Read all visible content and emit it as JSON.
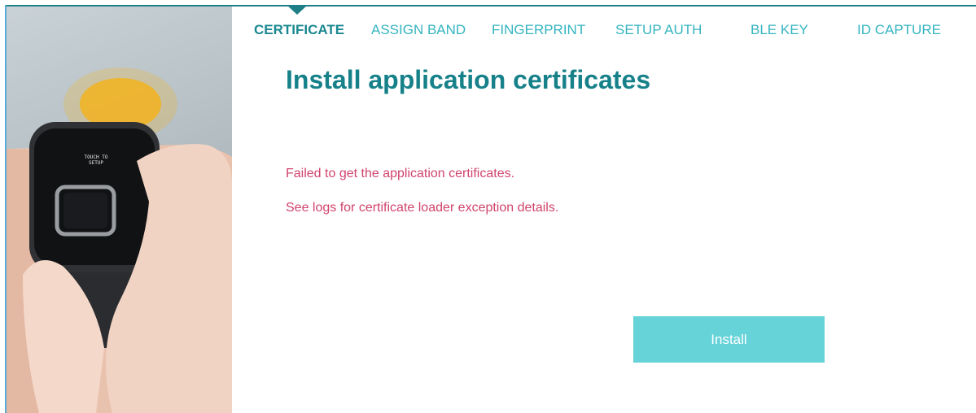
{
  "tabs": [
    {
      "label": "CERTIFICATE",
      "active": true
    },
    {
      "label": "ASSIGN BAND",
      "active": false
    },
    {
      "label": "FINGERPRINT",
      "active": false
    },
    {
      "label": "SETUP AUTH",
      "active": false
    },
    {
      "label": "BLE KEY",
      "active": false
    },
    {
      "label": "ID CAPTURE",
      "active": false
    }
  ],
  "main": {
    "title": "Install application certificates",
    "errors": [
      "Failed to get the application certificates.",
      "See logs for certificate loader exception details."
    ],
    "install_label": "Install"
  },
  "photo": {
    "watch_screen_text": "TOUCH TO SETUP"
  },
  "colors": {
    "accent": "#17818a",
    "tab_text": "#35b5c0",
    "error_text": "#d0436d",
    "button_bg": "#66d3d9"
  }
}
